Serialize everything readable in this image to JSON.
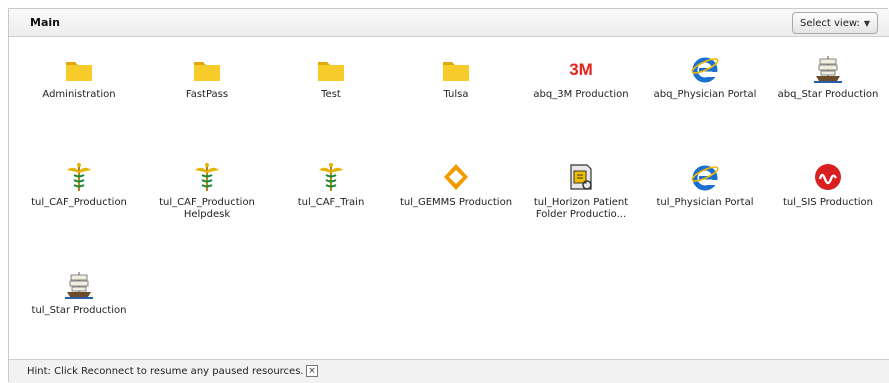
{
  "header": {
    "title": "Main",
    "select_view_label": "Select view:"
  },
  "resources": [
    {
      "label": "Administration",
      "icon": "folder-icon"
    },
    {
      "label": "FastPass",
      "icon": "folder-icon"
    },
    {
      "label": "Test",
      "icon": "folder-icon"
    },
    {
      "label": "Tulsa",
      "icon": "folder-icon"
    },
    {
      "label": "abq_3M Production",
      "icon": "3m-logo-icon"
    },
    {
      "label": "abq_Physician Portal",
      "icon": "internet-explorer-icon"
    },
    {
      "label": "abq_Star Production",
      "icon": "ship-icon"
    },
    {
      "label": "tul_CAF_Production",
      "icon": "caduceus-icon"
    },
    {
      "label": "tul_CAF_Production Helpdesk",
      "icon": "caduceus-icon"
    },
    {
      "label": "tul_CAF_Train",
      "icon": "caduceus-icon"
    },
    {
      "label": "tul_GEMMS Production",
      "icon": "gemms-diamond-icon"
    },
    {
      "label": "tul_Horizon Patient Folder Productio...",
      "icon": "patient-folder-icon"
    },
    {
      "label": "tul_Physician Portal",
      "icon": "internet-explorer-icon"
    },
    {
      "label": "tul_SIS Production",
      "icon": "sis-logo-icon"
    },
    {
      "label": "tul_Star Production",
      "icon": "ship-icon"
    }
  ],
  "hint": {
    "text": "Hint: Click Reconnect to resume any paused resources.",
    "close_label": "×"
  },
  "colors": {
    "folder": "#f5c400",
    "brand_3m": "#e2231a",
    "ie_blue": "#1a6fd1",
    "caduceus_gold": "#d8a600",
    "gemms_orange": "#f39a00",
    "sis_red": "#d92020"
  }
}
